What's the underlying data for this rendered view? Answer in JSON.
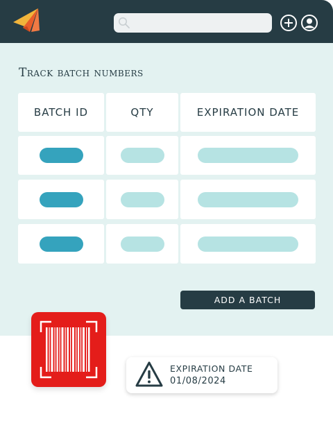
{
  "app": {
    "icons": {
      "logo": "paper-plane-logo",
      "search": "search-icon",
      "add": "plus-circle-icon",
      "user": "user-circle-icon"
    },
    "search": {
      "placeholder": "",
      "value": ""
    }
  },
  "page": {
    "title": "Track batch numbers"
  },
  "table": {
    "columns": [
      "BATCH ID",
      "QTY",
      "EXPIRATION DATE"
    ],
    "rows": 3
  },
  "actions": {
    "add_batch_label": "ADD A BATCH"
  },
  "barcode_card": {
    "icon": "barcode-scan-icon"
  },
  "expiry_notice": {
    "icon": "warning-triangle-icon",
    "label": "EXPIRATION DATE",
    "value": "01/08/2024"
  },
  "colors": {
    "header_bg": "#263c44",
    "panel_bg": "#e3f2f1",
    "accent_dark": "#35a3bd",
    "accent_light": "#b6e3e3",
    "barcode_red": "#e41d1a",
    "logo_orange": "#e95d2a",
    "logo_yellow": "#f1b43b"
  }
}
